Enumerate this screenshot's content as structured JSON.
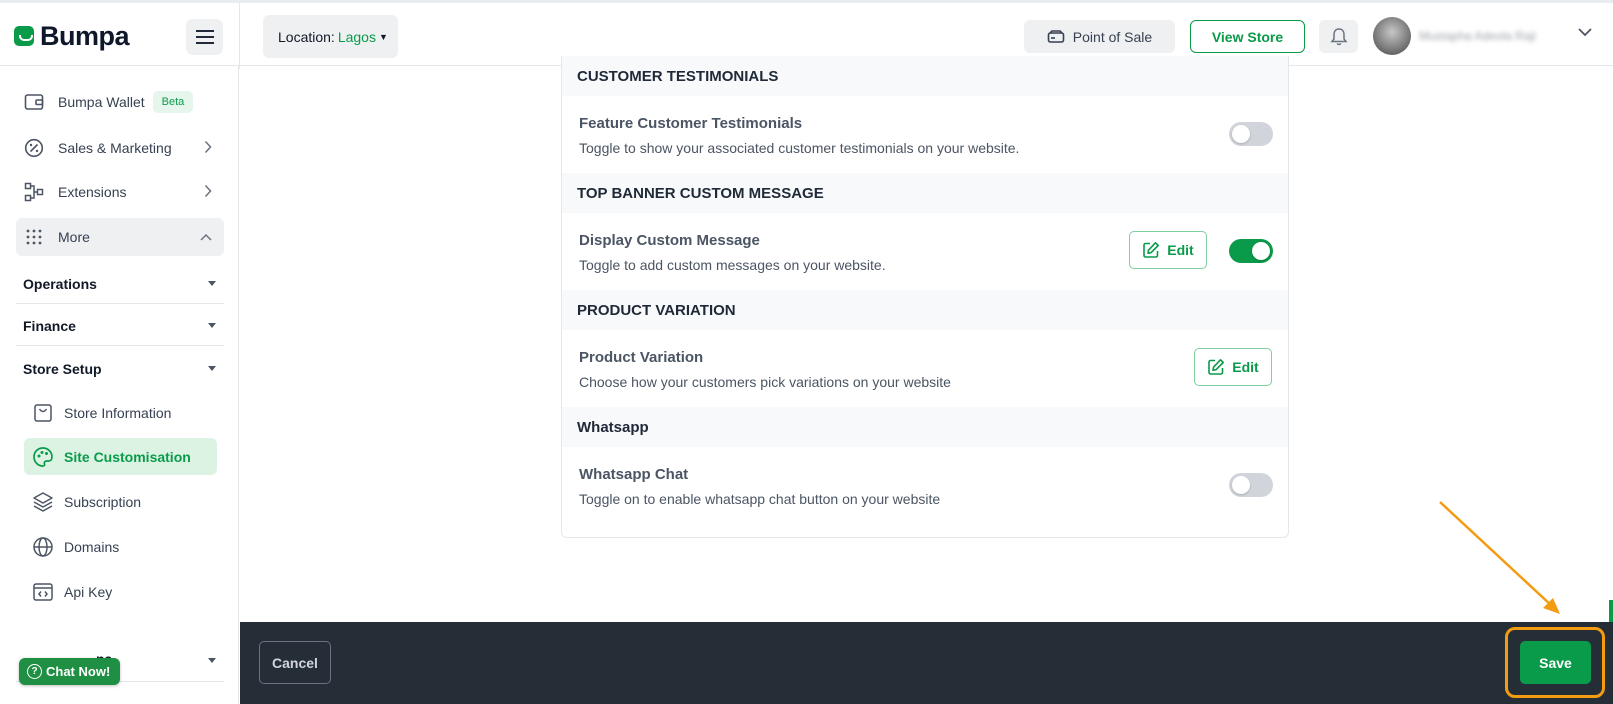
{
  "header": {
    "logo_text": "Bumpa",
    "location_label": "Location:",
    "location_value": "Lagos",
    "point_of_sale": "Point of Sale",
    "view_store": "View Store",
    "user_name": "Mustapha Adeola Raji"
  },
  "sidebar": {
    "items": [
      {
        "label": "Bumpa Wallet",
        "badge": "Beta"
      },
      {
        "label": "Sales & Marketing"
      },
      {
        "label": "Extensions"
      },
      {
        "label": "More"
      }
    ],
    "sections": [
      {
        "label": "Operations"
      },
      {
        "label": "Finance"
      },
      {
        "label": "Store Setup"
      }
    ],
    "store_setup_items": [
      {
        "label": "Store Information"
      },
      {
        "label": "Site Customisation"
      },
      {
        "label": "Subscription"
      },
      {
        "label": "Domains"
      },
      {
        "label": "Api Key"
      }
    ],
    "bottom_partial": "pa",
    "chat_now": "Chat Now!"
  },
  "content": {
    "sections": [
      {
        "heading": "CUSTOMER TESTIMONIALS",
        "title": "Feature Customer Testimonials",
        "desc": "Toggle to show your associated customer testimonials on your website.",
        "toggle": "off"
      },
      {
        "heading": "TOP BANNER CUSTOM MESSAGE",
        "title": "Display Custom Message",
        "desc": "Toggle to add custom messages on your website.",
        "toggle": "on",
        "edit": "Edit"
      },
      {
        "heading": "PRODUCT VARIATION",
        "title": "Product Variation",
        "desc": "Choose how your customers pick variations on your website",
        "edit": "Edit"
      },
      {
        "heading": "Whatsapp",
        "title": "Whatsapp Chat",
        "desc": "Toggle on to enable whatsapp chat button on your website",
        "toggle": "off"
      }
    ]
  },
  "footer": {
    "cancel": "Cancel",
    "save": "Save"
  },
  "colors": {
    "brand_green": "#0a9b4a",
    "footer_bg": "#252d37",
    "highlight": "#f39c12"
  }
}
